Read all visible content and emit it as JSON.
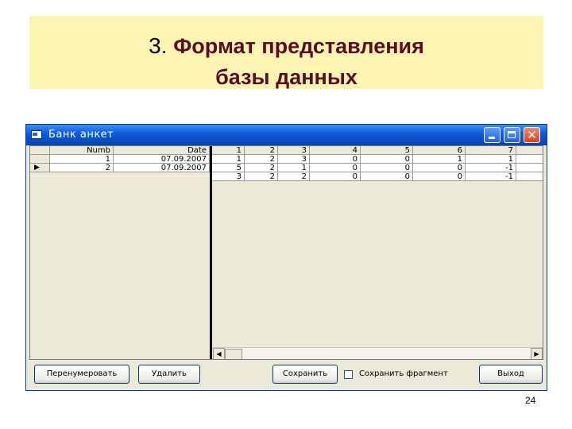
{
  "slide": {
    "title_number": "3.",
    "title_line1": "Формат представления",
    "title_line2": "базы данных",
    "page_number": "24"
  },
  "window": {
    "title": "Банк анкет",
    "close_glyph": "✕"
  },
  "grid": {
    "columns": [
      "",
      "Numb",
      "Date",
      "1",
      "2",
      "3",
      "4",
      "5",
      "6",
      "7"
    ],
    "rows": [
      [
        "",
        "1",
        "07.09.2007",
        "1",
        "2",
        "3",
        "0",
        "0",
        "1",
        "1"
      ],
      [
        "▶",
        "2",
        "07.09.2007",
        "5",
        "2",
        "1",
        "0",
        "0",
        "0",
        "-1"
      ],
      [
        "",
        "",
        "",
        "3",
        "2",
        "2",
        "0",
        "0",
        "0",
        "-1"
      ]
    ]
  },
  "buttons": {
    "renumber": "Перенумеровать",
    "delete": "Удалить",
    "save": "Сохранить",
    "save_fragment_label": "Сохранить фрагмент",
    "exit": "Выход"
  },
  "scrollbar": {
    "left_arrow": "◀",
    "right_arrow": "▶"
  },
  "colors": {
    "title_bg": "#fbf5b1",
    "title_text": "#5a0d21",
    "titlebar": "#0a5ad4",
    "window_bg": "#ece9d8"
  }
}
